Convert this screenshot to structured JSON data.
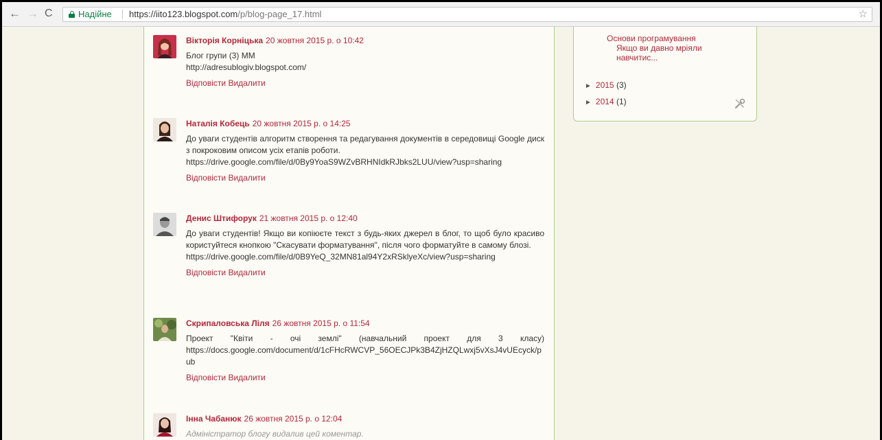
{
  "browser": {
    "back_glyph": "←",
    "forward_glyph": "→",
    "reload_glyph": "C",
    "secure_label": "Надійне",
    "url_base": "https://iito123.blogspot.com",
    "url_path": "/p/blog-page_17.html",
    "star_glyph": "☆"
  },
  "comments": [
    {
      "author": "Вікторія Корніцька",
      "date": "20 жовтня 2015 р. о 10:42",
      "lines": [
        "Блог групи (3) ММ",
        "http://adresublogiv.blogspot.com/"
      ],
      "reply": "Відповісти",
      "delete": "Видалити"
    },
    {
      "author": "Наталія Кобець",
      "date": "20 жовтня 2015 р. о 14:25",
      "lines": [
        "До уваги студентів алгоритм створення та редагування документів в середовищі Google диск з покроковим описом усіх етапів роботи.",
        "https://drive.google.com/file/d/0By9YoaS9WZvBRHNIdkRJbks2LUU/view?usp=sharing"
      ],
      "reply": "Відповісти",
      "delete": "Видалити"
    },
    {
      "author": "Денис Штифорук",
      "date": "21 жовтня 2015 р. о 12:40",
      "lines": [
        "До уваги студентів! Якщо ви копіюєте текст з будь-яких джерел в блог, то щоб було красиво користуйтеся кнопкою \"Скасувати форматування\", після чого форматуйте в самому блозі.",
        "https://drive.google.com/file/d/0B9YeQ_32MN81al94Y2xRSklyeXc/view?usp=sharing"
      ],
      "reply": "Відповісти",
      "delete": "Видалити"
    },
    {
      "author": "Скрипаловська Ліля",
      "date": "26 жовтня 2015 р. о 11:54",
      "lines": [
        "Проект \"Квіти - очі землі\" (навчальний проект для 3 класу) https://docs.google.com/document/d/1cFHcRWCVP_56OECJPk3B4ZjHZQLwxj5vXsJ4vUEcyck/pub"
      ],
      "reply": "Відповісти",
      "delete": "Видалити"
    },
    {
      "author": "Інна Чабанюк",
      "date": "26 жовтня 2015 р. о 12:04",
      "deleted_note": "Адміністратор блогу видалив цей коментар."
    }
  ],
  "sidebar": {
    "post_title": "Основи програмування",
    "post_snippet": "Якщо ви давно мріяли навчитис...",
    "archive": [
      {
        "year": "2015",
        "count": "(3)"
      },
      {
        "year": "2014",
        "count": "(1)"
      }
    ],
    "archive_marker": "►"
  },
  "colors": {
    "link": "#b3273b",
    "border_green": "#a8d08b",
    "page_bg": "#f6f3e9",
    "secure_green": "#0b8043"
  }
}
